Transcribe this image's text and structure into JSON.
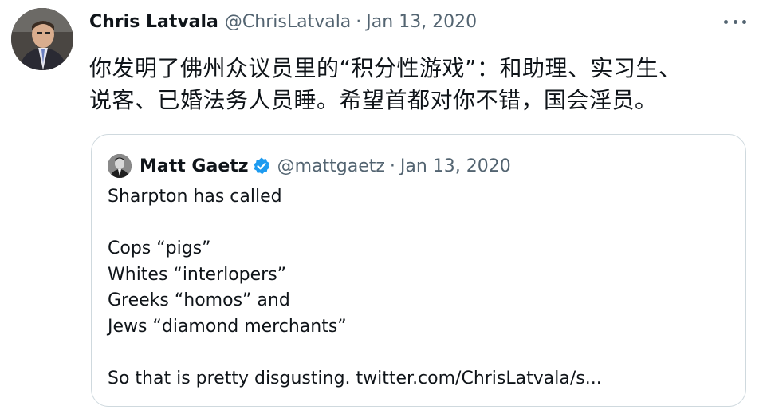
{
  "tweet": {
    "author_name": "Chris Latvala",
    "author_handle": "@ChrisLatvala",
    "separator": "·",
    "date": "Jan 13, 2020",
    "text_line1": "你发明了佛州众议员里的“积分性游戏”：和助理、实习生、",
    "text_line2": "说客、已婚法务人员睡。希望首都对你不错，国会淫员。"
  },
  "quoted_tweet": {
    "author_name": "Matt Gaetz",
    "author_handle": "@mattgaetz",
    "separator": "·",
    "date": "Jan 13, 2020",
    "lines": [
      "Sharpton has called",
      "",
      "Cops “pigs”",
      "Whites “interlopers”",
      "Greeks “homos” and",
      "Jews “diamond merchants”",
      "",
      "So that is pretty disgusting. twitter.com/ChrisLatvala/s..."
    ]
  },
  "icons": {
    "more": "more-icon",
    "verified": "verified-badge-icon"
  },
  "colors": {
    "secondary_text": "#536471",
    "verified_blue": "#1d9bf0",
    "border": "#cfd9de"
  }
}
